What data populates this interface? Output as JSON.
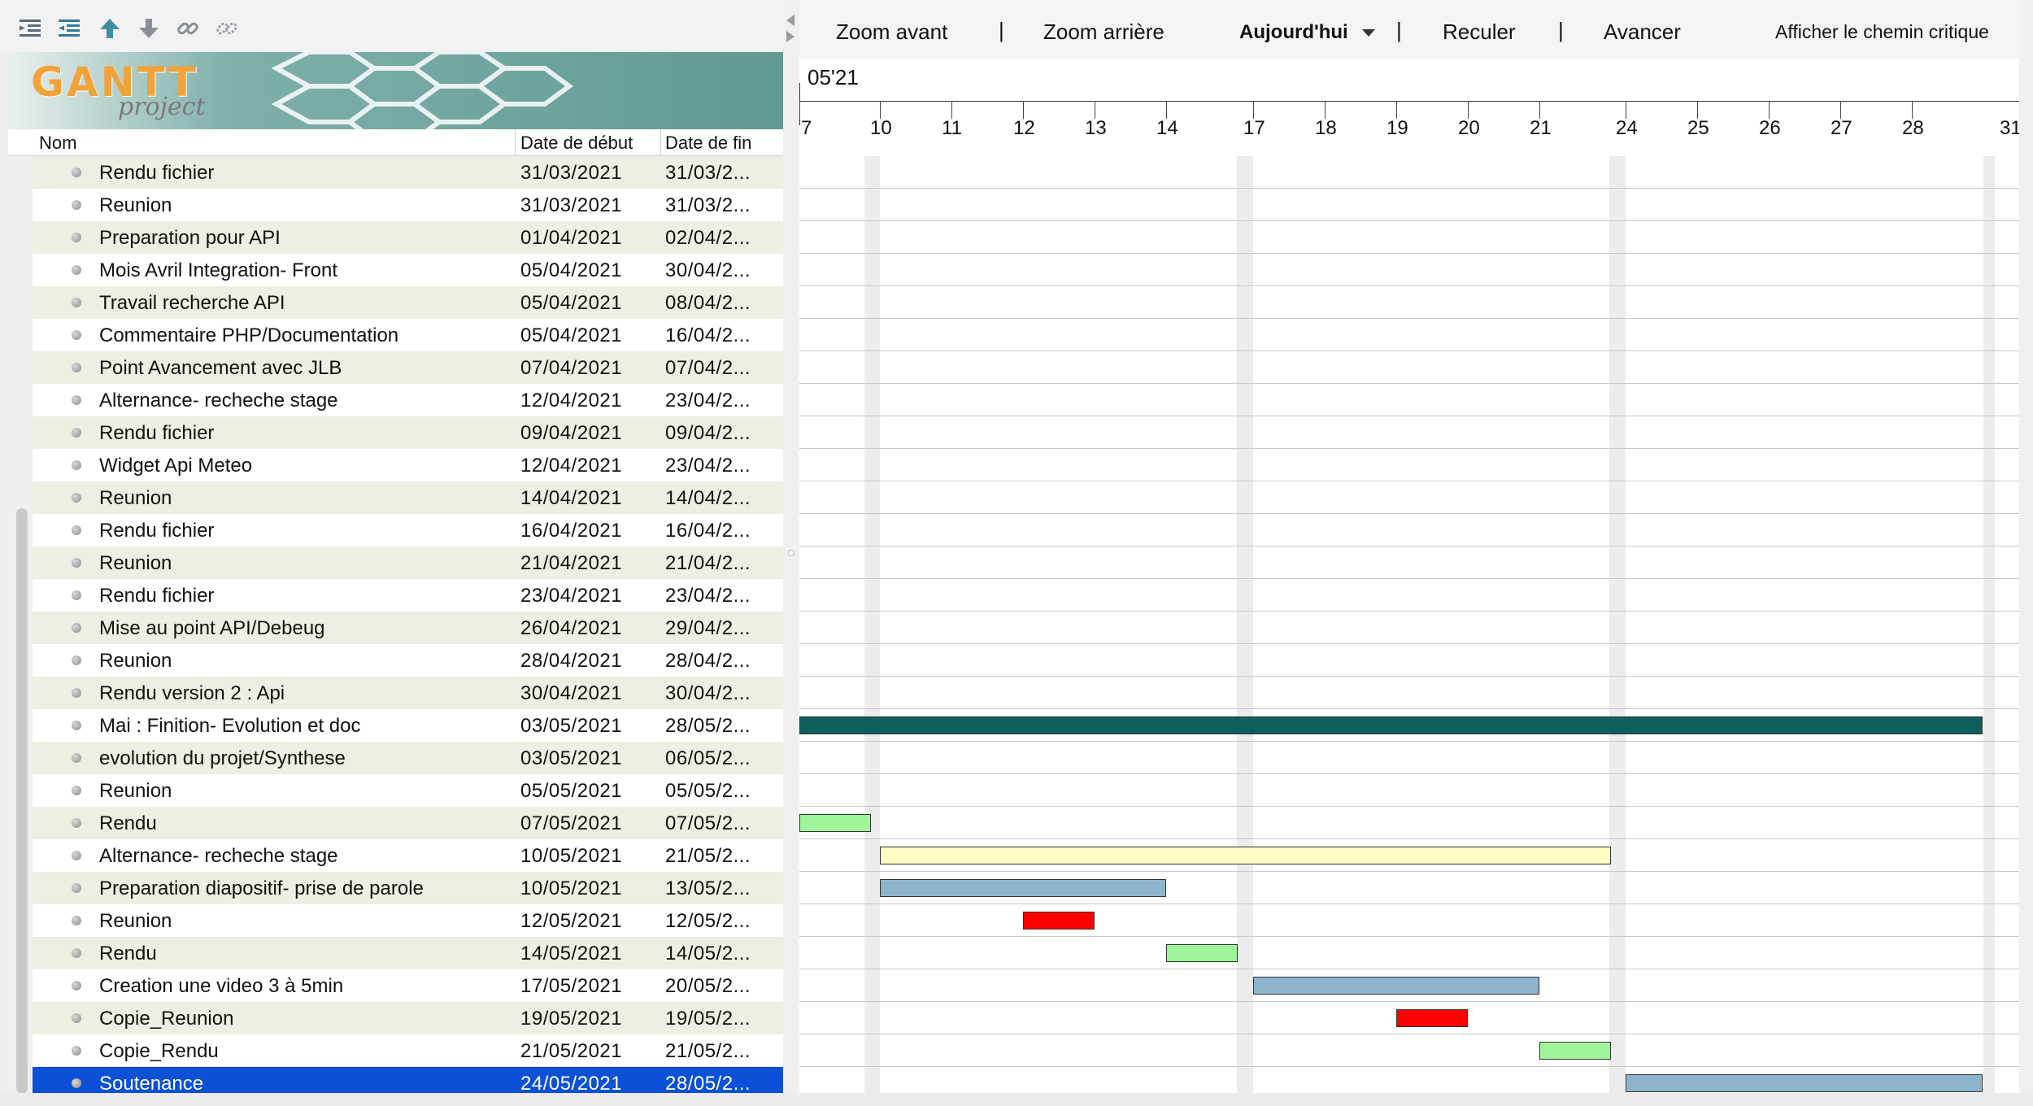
{
  "toolbar": {
    "zoom_in": "Zoom avant",
    "zoom_out": "Zoom arrière",
    "today": "Aujourd'hui",
    "back": "Reculer",
    "forward": "Avancer",
    "critical_path": "Afficher le chemin critique",
    "separator": "|"
  },
  "logo": {
    "main": "GANTT",
    "sub": "project"
  },
  "columns": {
    "name": "Nom",
    "start": "Date de début",
    "end": "Date de fin"
  },
  "timeline": {
    "month": "05'21",
    "days": [
      "7",
      "10",
      "11",
      "12",
      "13",
      "14",
      "17",
      "18",
      "19",
      "20",
      "21",
      "24",
      "25",
      "26",
      "27",
      "28",
      "31"
    ]
  },
  "tasks": [
    {
      "name": "Rendu  fichier",
      "start": "31/03/2021",
      "end": "31/03/2..."
    },
    {
      "name": "Reunion",
      "start": "31/03/2021",
      "end": "31/03/2..."
    },
    {
      "name": "Preparation pour API",
      "start": "01/04/2021",
      "end": "02/04/2..."
    },
    {
      "name": "Mois Avril Integration- Front",
      "start": "05/04/2021",
      "end": "30/04/2..."
    },
    {
      "name": "Travail recherche API",
      "start": "05/04/2021",
      "end": "08/04/2..."
    },
    {
      "name": "Commentaire PHP/Documentation",
      "start": "05/04/2021",
      "end": "16/04/2..."
    },
    {
      "name": "Point Avancement avec JLB",
      "start": "07/04/2021",
      "end": "07/04/2..."
    },
    {
      "name": "Alternance- recheche stage",
      "start": "12/04/2021",
      "end": "23/04/2..."
    },
    {
      "name": "Rendu  fichier",
      "start": "09/04/2021",
      "end": "09/04/2..."
    },
    {
      "name": "Widget Api Meteo",
      "start": "12/04/2021",
      "end": "23/04/2..."
    },
    {
      "name": "Reunion",
      "start": "14/04/2021",
      "end": "14/04/2..."
    },
    {
      "name": "Rendu  fichier",
      "start": "16/04/2021",
      "end": "16/04/2..."
    },
    {
      "name": "Reunion",
      "start": "21/04/2021",
      "end": "21/04/2..."
    },
    {
      "name": "Rendu  fichier",
      "start": "23/04/2021",
      "end": "23/04/2..."
    },
    {
      "name": "Mise au point API/Debeug",
      "start": "26/04/2021",
      "end": "29/04/2..."
    },
    {
      "name": "Reunion",
      "start": "28/04/2021",
      "end": "28/04/2..."
    },
    {
      "name": "Rendu version 2 : Api",
      "start": "30/04/2021",
      "end": "30/04/2..."
    },
    {
      "name": "Mai : Finition- Evolution et doc",
      "start": "03/05/2021",
      "end": "28/05/2..."
    },
    {
      "name": "evolution du projet/Synthese",
      "start": "03/05/2021",
      "end": "06/05/2..."
    },
    {
      "name": "Reunion",
      "start": "05/05/2021",
      "end": "05/05/2..."
    },
    {
      "name": "Rendu",
      "start": "07/05/2021",
      "end": "07/05/2..."
    },
    {
      "name": "Alternance- recheche stage",
      "start": "10/05/2021",
      "end": "21/05/2..."
    },
    {
      "name": "Preparation diapositif- prise de parole",
      "start": "10/05/2021",
      "end": "13/05/2..."
    },
    {
      "name": "Reunion",
      "start": "12/05/2021",
      "end": "12/05/2..."
    },
    {
      "name": "Rendu",
      "start": "14/05/2021",
      "end": "14/05/2..."
    },
    {
      "name": "Creation une video 3 à 5min",
      "start": "17/05/2021",
      "end": "20/05/2..."
    },
    {
      "name": "Copie_Reunion",
      "start": "19/05/2021",
      "end": "19/05/2..."
    },
    {
      "name": "Copie_Rendu",
      "start": "21/05/2021",
      "end": "21/05/2..."
    },
    {
      "name": "Soutenance",
      "start": "24/05/2021",
      "end": "28/05/2...",
      "selected": true
    }
  ],
  "chart_data": {
    "type": "gantt",
    "visible_range": {
      "start": "07/05/2021",
      "end": "31/05/2021"
    },
    "bars": [
      {
        "task": "Mai : Finition- Evolution et doc",
        "start": "2021-05-03",
        "end": "2021-05-28",
        "color": "#0e5f5c"
      },
      {
        "task": "Rendu",
        "start": "2021-05-07",
        "end": "2021-05-07",
        "color": "#9ef59a"
      },
      {
        "task": "Alternance- recheche stage",
        "start": "2021-05-10",
        "end": "2021-05-21",
        "color": "#fdfdc4"
      },
      {
        "task": "Preparation diapositif- prise de parole",
        "start": "2021-05-10",
        "end": "2021-05-13",
        "color": "#8eb3cd"
      },
      {
        "task": "Reunion",
        "start": "2021-05-12",
        "end": "2021-05-12",
        "color": "#ff0000"
      },
      {
        "task": "Rendu",
        "start": "2021-05-14",
        "end": "2021-05-14",
        "color": "#9ef59a"
      },
      {
        "task": "Creation une video 3 à 5min",
        "start": "2021-05-17",
        "end": "2021-05-20",
        "color": "#8eb3cd"
      },
      {
        "task": "Copie_Reunion",
        "start": "2021-05-19",
        "end": "2021-05-19",
        "color": "#ff0000"
      },
      {
        "task": "Copie_Rendu",
        "start": "2021-05-21",
        "end": "2021-05-21",
        "color": "#9ef59a"
      },
      {
        "task": "Soutenance",
        "start": "2021-05-24",
        "end": "2021-05-28",
        "color": "#8eb3cd"
      }
    ]
  },
  "colors": {
    "selection": "#0b50d6",
    "row_alt": "#eeeee2",
    "weekend": "#ececec",
    "logo_accent": "#f2a23a"
  }
}
